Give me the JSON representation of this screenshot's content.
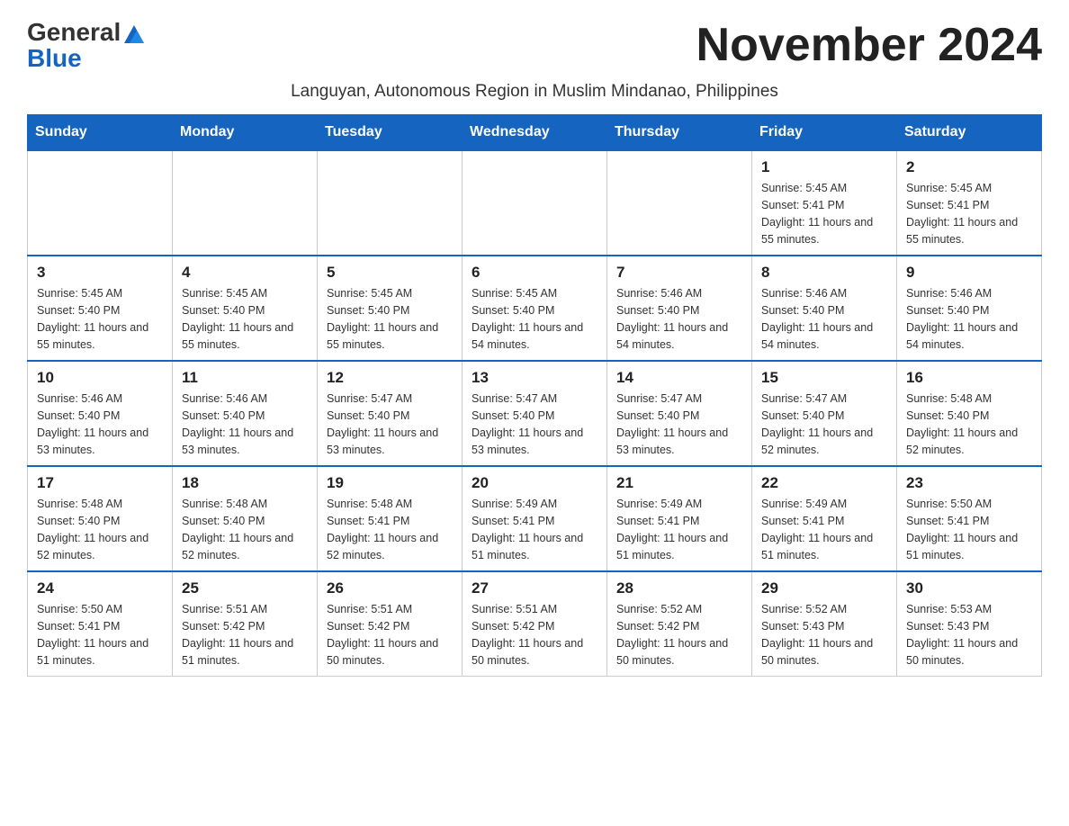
{
  "header": {
    "logo_general": "General",
    "logo_blue": "Blue",
    "month_title": "November 2024",
    "subtitle": "Languyan, Autonomous Region in Muslim Mindanao, Philippines"
  },
  "days_of_week": [
    "Sunday",
    "Monday",
    "Tuesday",
    "Wednesday",
    "Thursday",
    "Friday",
    "Saturday"
  ],
  "weeks": [
    {
      "days": [
        {
          "number": "",
          "info": ""
        },
        {
          "number": "",
          "info": ""
        },
        {
          "number": "",
          "info": ""
        },
        {
          "number": "",
          "info": ""
        },
        {
          "number": "",
          "info": ""
        },
        {
          "number": "1",
          "info": "Sunrise: 5:45 AM\nSunset: 5:41 PM\nDaylight: 11 hours and 55 minutes."
        },
        {
          "number": "2",
          "info": "Sunrise: 5:45 AM\nSunset: 5:41 PM\nDaylight: 11 hours and 55 minutes."
        }
      ]
    },
    {
      "days": [
        {
          "number": "3",
          "info": "Sunrise: 5:45 AM\nSunset: 5:40 PM\nDaylight: 11 hours and 55 minutes."
        },
        {
          "number": "4",
          "info": "Sunrise: 5:45 AM\nSunset: 5:40 PM\nDaylight: 11 hours and 55 minutes."
        },
        {
          "number": "5",
          "info": "Sunrise: 5:45 AM\nSunset: 5:40 PM\nDaylight: 11 hours and 55 minutes."
        },
        {
          "number": "6",
          "info": "Sunrise: 5:45 AM\nSunset: 5:40 PM\nDaylight: 11 hours and 54 minutes."
        },
        {
          "number": "7",
          "info": "Sunrise: 5:46 AM\nSunset: 5:40 PM\nDaylight: 11 hours and 54 minutes."
        },
        {
          "number": "8",
          "info": "Sunrise: 5:46 AM\nSunset: 5:40 PM\nDaylight: 11 hours and 54 minutes."
        },
        {
          "number": "9",
          "info": "Sunrise: 5:46 AM\nSunset: 5:40 PM\nDaylight: 11 hours and 54 minutes."
        }
      ]
    },
    {
      "days": [
        {
          "number": "10",
          "info": "Sunrise: 5:46 AM\nSunset: 5:40 PM\nDaylight: 11 hours and 53 minutes."
        },
        {
          "number": "11",
          "info": "Sunrise: 5:46 AM\nSunset: 5:40 PM\nDaylight: 11 hours and 53 minutes."
        },
        {
          "number": "12",
          "info": "Sunrise: 5:47 AM\nSunset: 5:40 PM\nDaylight: 11 hours and 53 minutes."
        },
        {
          "number": "13",
          "info": "Sunrise: 5:47 AM\nSunset: 5:40 PM\nDaylight: 11 hours and 53 minutes."
        },
        {
          "number": "14",
          "info": "Sunrise: 5:47 AM\nSunset: 5:40 PM\nDaylight: 11 hours and 53 minutes."
        },
        {
          "number": "15",
          "info": "Sunrise: 5:47 AM\nSunset: 5:40 PM\nDaylight: 11 hours and 52 minutes."
        },
        {
          "number": "16",
          "info": "Sunrise: 5:48 AM\nSunset: 5:40 PM\nDaylight: 11 hours and 52 minutes."
        }
      ]
    },
    {
      "days": [
        {
          "number": "17",
          "info": "Sunrise: 5:48 AM\nSunset: 5:40 PM\nDaylight: 11 hours and 52 minutes."
        },
        {
          "number": "18",
          "info": "Sunrise: 5:48 AM\nSunset: 5:40 PM\nDaylight: 11 hours and 52 minutes."
        },
        {
          "number": "19",
          "info": "Sunrise: 5:48 AM\nSunset: 5:41 PM\nDaylight: 11 hours and 52 minutes."
        },
        {
          "number": "20",
          "info": "Sunrise: 5:49 AM\nSunset: 5:41 PM\nDaylight: 11 hours and 51 minutes."
        },
        {
          "number": "21",
          "info": "Sunrise: 5:49 AM\nSunset: 5:41 PM\nDaylight: 11 hours and 51 minutes."
        },
        {
          "number": "22",
          "info": "Sunrise: 5:49 AM\nSunset: 5:41 PM\nDaylight: 11 hours and 51 minutes."
        },
        {
          "number": "23",
          "info": "Sunrise: 5:50 AM\nSunset: 5:41 PM\nDaylight: 11 hours and 51 minutes."
        }
      ]
    },
    {
      "days": [
        {
          "number": "24",
          "info": "Sunrise: 5:50 AM\nSunset: 5:41 PM\nDaylight: 11 hours and 51 minutes."
        },
        {
          "number": "25",
          "info": "Sunrise: 5:51 AM\nSunset: 5:42 PM\nDaylight: 11 hours and 51 minutes."
        },
        {
          "number": "26",
          "info": "Sunrise: 5:51 AM\nSunset: 5:42 PM\nDaylight: 11 hours and 50 minutes."
        },
        {
          "number": "27",
          "info": "Sunrise: 5:51 AM\nSunset: 5:42 PM\nDaylight: 11 hours and 50 minutes."
        },
        {
          "number": "28",
          "info": "Sunrise: 5:52 AM\nSunset: 5:42 PM\nDaylight: 11 hours and 50 minutes."
        },
        {
          "number": "29",
          "info": "Sunrise: 5:52 AM\nSunset: 5:43 PM\nDaylight: 11 hours and 50 minutes."
        },
        {
          "number": "30",
          "info": "Sunrise: 5:53 AM\nSunset: 5:43 PM\nDaylight: 11 hours and 50 minutes."
        }
      ]
    }
  ]
}
